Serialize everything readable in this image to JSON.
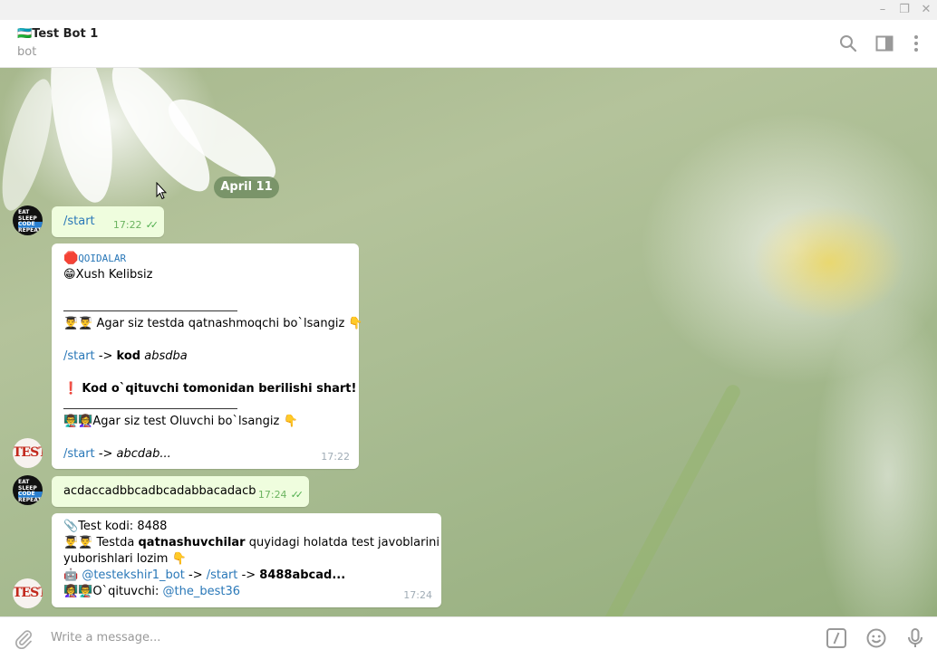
{
  "window": {
    "minimize": "–",
    "restore": "❐",
    "close": "✕"
  },
  "header": {
    "flag": "🇺🇿",
    "title": "Test Bot 1",
    "subtitle": "bot"
  },
  "date_separator": "April 11",
  "messages": {
    "m1": {
      "text": "/start",
      "time": "17:22",
      "ticks": "✓✓"
    },
    "m2": {
      "l1_emoji": "🛑",
      "l1_text": "QOIDALAR",
      "l2_emoji": "😁",
      "l2_text": "Xush Kelibsiz",
      "l3_emoji": "👨‍🎓👨‍🎓",
      "l3_text": "Agar siz testda qatnashmoqchi bo`lsangiz",
      "l3_point": "👇",
      "l4_cmd": "/start",
      "l4_arrow": "->",
      "l4_bold": "kod",
      "l4_italic": "absdba",
      "l5_emoji": "❗",
      "l5_text": "Kod o`qituvchi tomonidan berilishi shart!",
      "l6_emoji": "👨‍🏫👩‍🏫",
      "l6_text": "Agar siz test Oluvchi bo`lsangiz",
      "l6_point": "👇",
      "l7_cmd": "/start",
      "l7_arrow": "->",
      "l7_italic": "abcdab...",
      "time": "17:22"
    },
    "m3": {
      "text": "acdaccadbbcadbcadabbacadacb",
      "time": "17:24",
      "ticks": "✓✓"
    },
    "m4": {
      "l1_emoji": "📎",
      "l1_text": "Test kodi: 8488",
      "l2_emoji": "👨‍🎓👨‍🎓",
      "l2_a": "Testda",
      "l2_bold": "qatnashuvchilar",
      "l2_b": "quyidagi holatda test javoblarini",
      "l3_text": "yuborishlari lozim",
      "l3_point": "👇",
      "l4_emoji": "🤖",
      "l4_bot": "@testekshir1_bot",
      "l4_arrow1": "->",
      "l4_cmd": "/start",
      "l4_arrow2": "->",
      "l4_bold": "8488abcad...",
      "l5_emoji": "👩‍🏫👨‍🏫",
      "l5_text": "O`qituvchi:",
      "l5_user": "@the_best36",
      "time": "17:24"
    }
  },
  "avatars": {
    "bot": "TEST",
    "user": [
      "EAT",
      "SLEEP",
      "CODE",
      "REPEAT"
    ]
  },
  "composer": {
    "placeholder": "Write a message..."
  }
}
